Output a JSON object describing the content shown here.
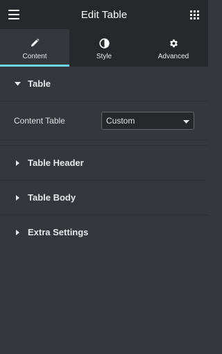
{
  "header": {
    "title": "Edit Table",
    "menu_icon": "hamburger-icon",
    "apps_icon": "grid-icon"
  },
  "tabs": [
    {
      "label": "Content",
      "icon": "pencil-icon",
      "active": true
    },
    {
      "label": "Style",
      "icon": "half-circle-icon",
      "active": false
    },
    {
      "label": "Advanced",
      "icon": "gear-icon",
      "active": false
    }
  ],
  "sections": {
    "table": {
      "label": "Table",
      "expanded": true
    },
    "content_table": {
      "label": "Content Table",
      "selected": "Custom"
    },
    "table_header": {
      "label": "Table Header"
    },
    "table_body": {
      "label": "Table Body"
    },
    "extra_settings": {
      "label": "Extra Settings"
    }
  },
  "colors": {
    "header_bg": "#26292c",
    "panel_bg": "#34383c",
    "accent": "#71d7f7"
  }
}
